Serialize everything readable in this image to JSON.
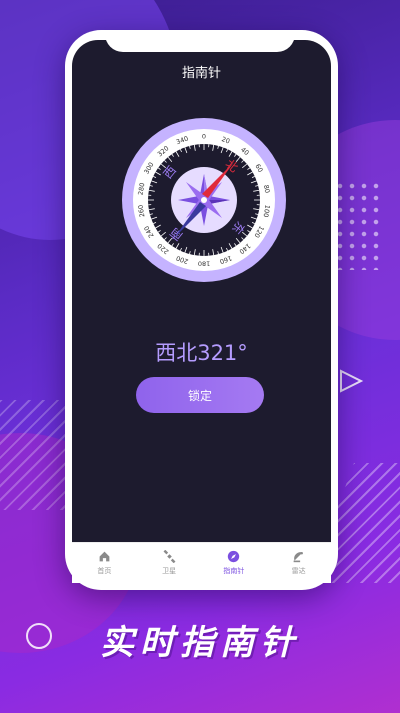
{
  "app": {
    "title": "指南针"
  },
  "compass": {
    "cardinals": {
      "north": "北",
      "east": "东",
      "south": "南",
      "west": "西"
    },
    "degree_labels": [
      "0",
      "20",
      "40",
      "60",
      "80",
      "100",
      "120",
      "140",
      "160",
      "180",
      "200",
      "220",
      "240",
      "260",
      "280",
      "300",
      "320",
      "340"
    ],
    "heading_degrees": 321,
    "colors": {
      "outer_ring": "#c5b3ff",
      "dial_face": "#1d1b2e",
      "center": "#e6dcff",
      "needle_north": "#e02b3c",
      "needle_south": "#3a3a9e",
      "star": "#7a4fe0"
    }
  },
  "reading": {
    "text": "西北321°"
  },
  "actions": {
    "lock_label": "锁定"
  },
  "tabbar": {
    "items": [
      {
        "label": "首页",
        "icon": "home-icon",
        "active": false
      },
      {
        "label": "卫星",
        "icon": "satellite-icon",
        "active": false
      },
      {
        "label": "指南针",
        "icon": "compass-icon",
        "active": true
      },
      {
        "label": "雷达",
        "icon": "radar-icon",
        "active": false
      }
    ]
  },
  "promo": {
    "slogan": "实时指南针"
  },
  "colors": {
    "accent": "#8f63ec",
    "background": "#6d2fd9",
    "screen": "#1d1b2e"
  }
}
